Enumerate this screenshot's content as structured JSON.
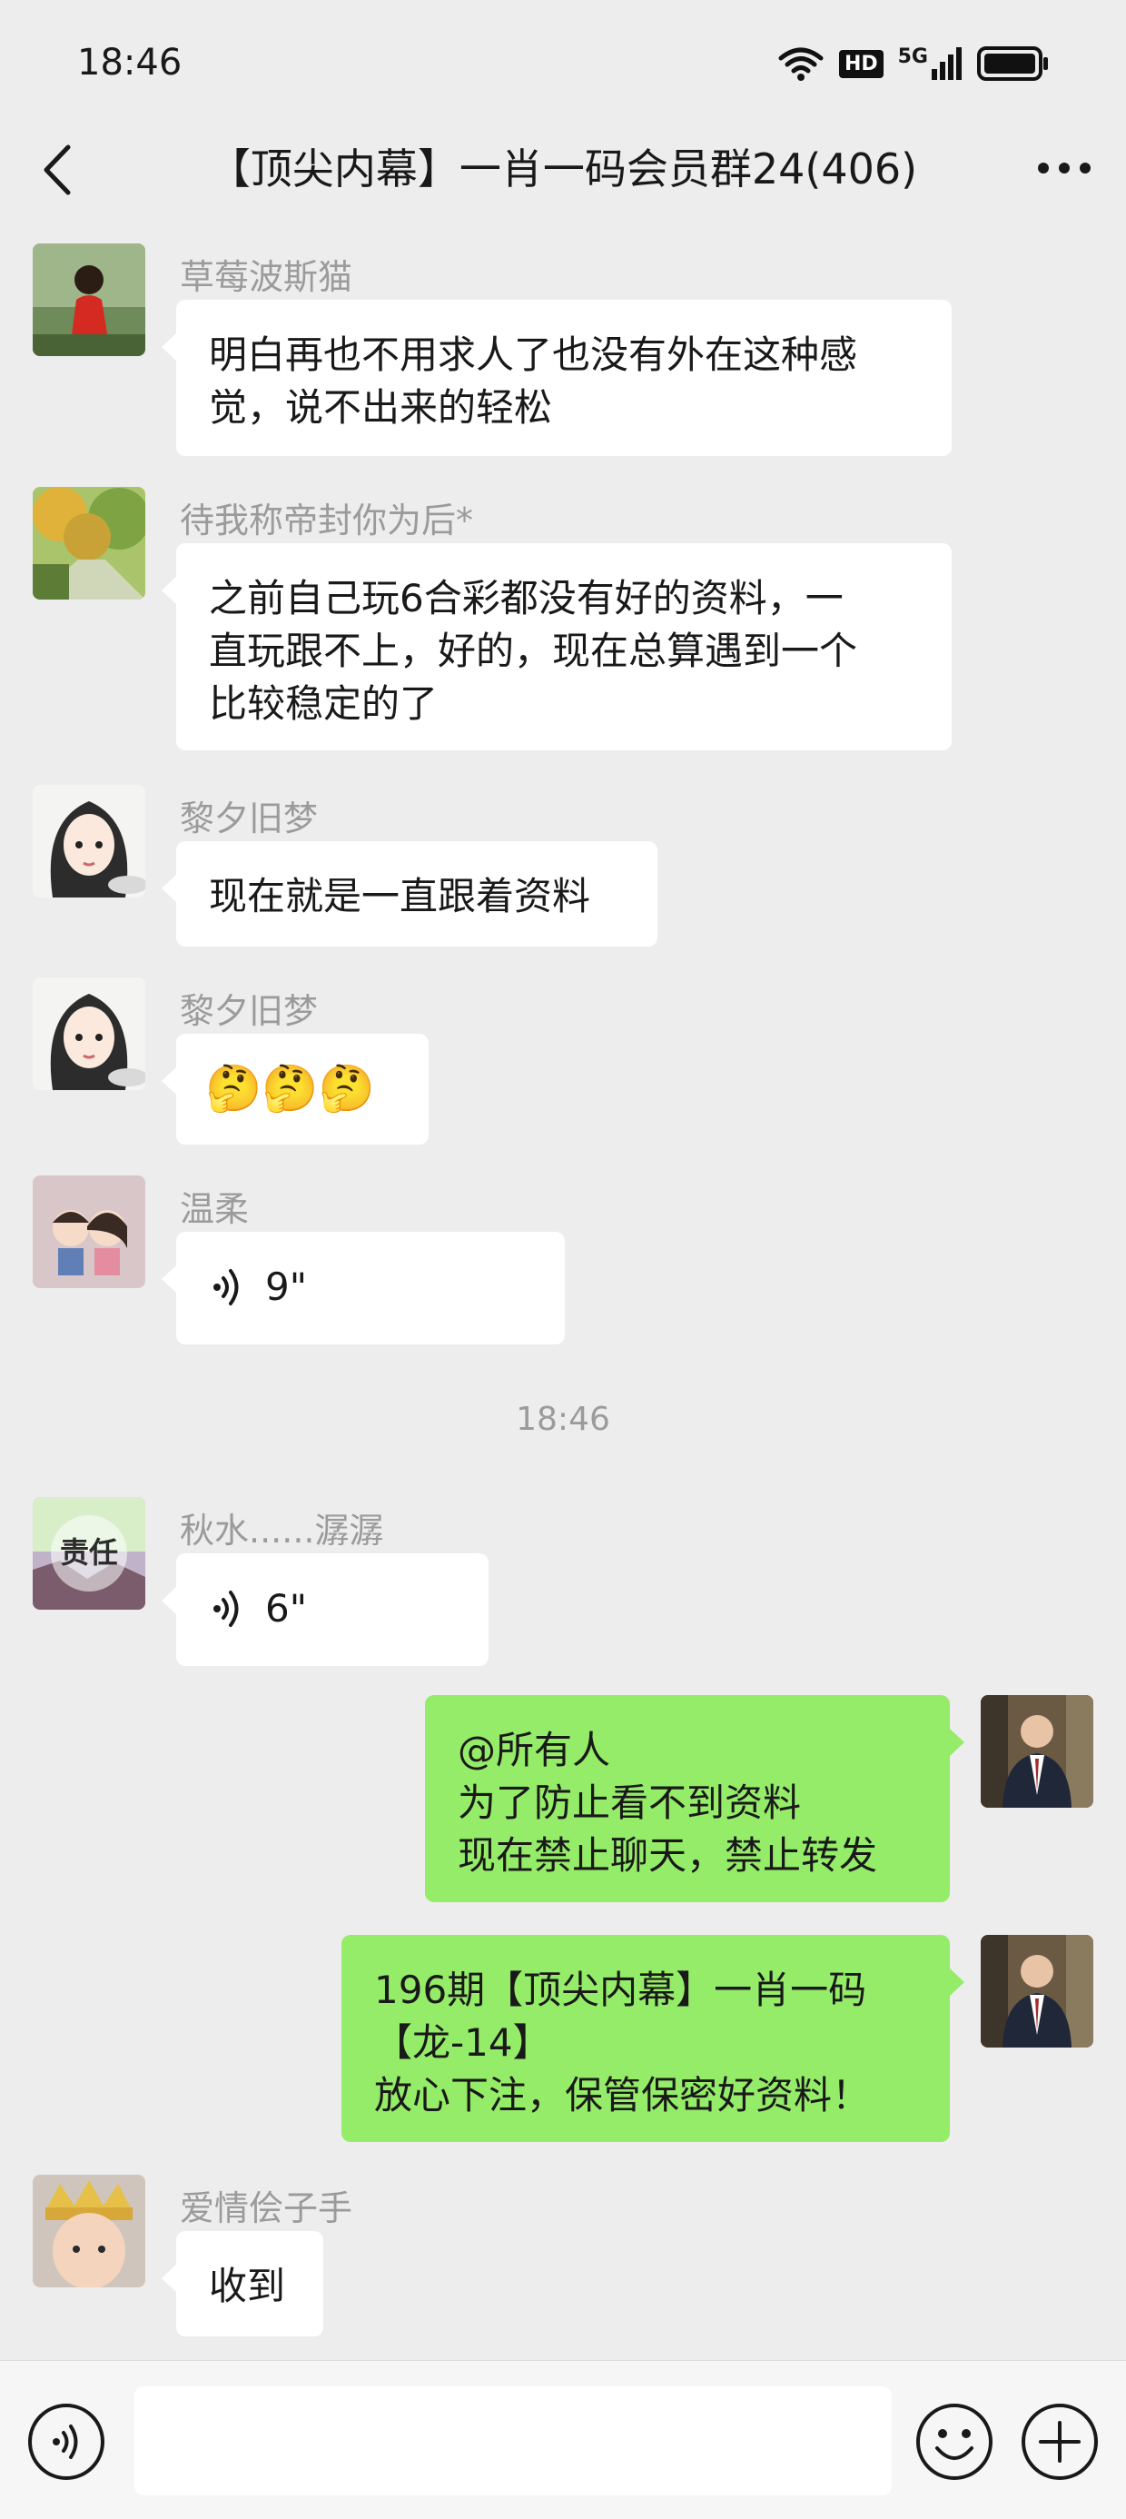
{
  "status_bar": {
    "time": "18:46",
    "network": "5G",
    "hd_label": "HD"
  },
  "header": {
    "title": "【顶尖内幕】一肖一码会员群24(406)"
  },
  "messages": [
    {
      "sender": "草莓波斯猫",
      "lines": [
        "明白再也不用求人了也没有外在这种感",
        "觉，说不出来的轻松"
      ]
    },
    {
      "sender": "待我称帝封你为后*",
      "lines": [
        "之前自己玩6合彩都没有好的资料，一",
        "直玩跟不上，好的，现在总算遇到一个",
        "比较稳定的了"
      ]
    },
    {
      "sender": "黎夕旧梦",
      "lines": [
        "现在就是一直跟着资料"
      ]
    },
    {
      "sender": "黎夕旧梦",
      "emoji": "🤔🤔🤔"
    },
    {
      "sender": "温柔",
      "voice_duration": "9\""
    },
    {
      "sender": "秋水......潺潺",
      "voice_duration": "6\"",
      "avatar_text": "责任"
    },
    {
      "lines": [
        "@所有人",
        "为了防止看不到资料",
        "现在禁止聊天，禁止转发"
      ]
    },
    {
      "lines": [
        "196期【顶尖内幕】一肖一码",
        "【龙-14】",
        "放心下注，保管保密好资料！"
      ]
    },
    {
      "sender": "爱情侩子手",
      "lines": [
        "收到"
      ]
    }
  ],
  "time_divider": "18:46",
  "input_bar": {
    "placeholder": ""
  },
  "colors": {
    "background": "#ededed",
    "own_bubble": "#95ec69",
    "other_bubble": "#ffffff",
    "name_gray": "#9b9b9b"
  },
  "icons": [
    "back-arrow-icon",
    "more-dots-icon",
    "voice-toggle-icon",
    "emoji-icon",
    "plus-icon",
    "wifi-icon",
    "signal-icon",
    "battery-icon",
    "voice-wave-icon"
  ]
}
